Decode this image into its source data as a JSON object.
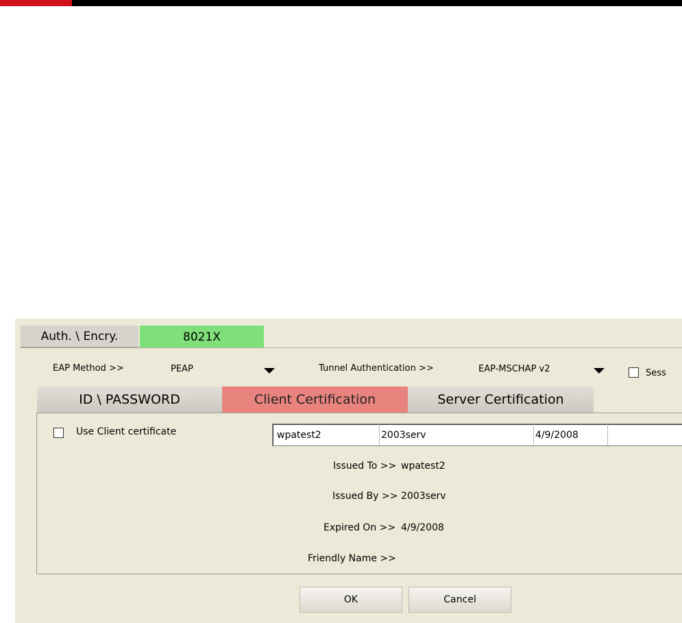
{
  "tabs": {
    "auth": "Auth. \\ Encry.",
    "x8021": "8021X"
  },
  "eap": {
    "method_label": "EAP Method >>",
    "method_value": "PEAP",
    "tunnel_label": "Tunnel Authentication >>",
    "tunnel_value": "EAP-MSCHAP v2",
    "session_label": "Sess"
  },
  "subtabs": {
    "id_password": "ID \\ PASSWORD",
    "client_cert": "Client Certification",
    "server_cert": "Server Certification"
  },
  "client": {
    "use_cert_label": "Use Client certificate",
    "use_cert_checked": false,
    "cert_row": [
      "wpatest2",
      "2003serv",
      "4/9/2008"
    ],
    "issued_to_label": "Issued To >>",
    "issued_to_value": "wpatest2",
    "issued_by_label": "Issued By >>",
    "issued_by_value": "2003serv",
    "expired_on_label": "Expired On >>",
    "expired_on_value": "4/9/2008",
    "friendly_name_label": "Friendly Name >>",
    "friendly_name_value": ""
  },
  "buttons": {
    "ok": "OK",
    "cancel": "Cancel"
  },
  "colors": {
    "tab_active": "#7fe07a",
    "subtab_active": "#e8837e",
    "panel_bg": "#ece9d8",
    "top_accent": "#d0101c"
  }
}
